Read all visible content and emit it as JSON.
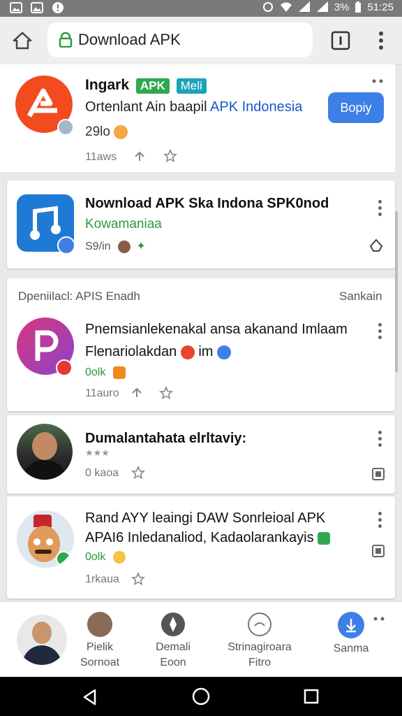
{
  "status_bar": {
    "battery": "3%",
    "time": "51:25"
  },
  "url_bar": {
    "url": "Download APK"
  },
  "cards": {
    "c1": {
      "name": "Ingark",
      "badge1": "APK",
      "badge2": "Meli",
      "subtitle_a": "Ortenlant Ain baapil ",
      "subtitle_b": "APK Indonesia",
      "rating": "29lo",
      "meta": "11aws",
      "button": "Bopiy"
    },
    "c2": {
      "title": "Nownload APK Ska Indona SPK0nod",
      "subtitle": "Kowamaniaa",
      "size": "S9/in"
    },
    "section": {
      "left": "Dpeniilacl: APIS Enadh",
      "right": "Sankain"
    },
    "c3": {
      "line1": "Pnemsianlekenakal ansa akanand Imlaam",
      "line2a": "Flenariolakdan ",
      "line2b": "im",
      "rating": "0olk",
      "meta": "11auro"
    },
    "c4": {
      "title": "Dumalantahata elrltaviy:",
      "stars": "★★★",
      "meta": "0 kaoa"
    },
    "c5": {
      "line1": "Rand AYY leaingi DAW Sonrleioal APK",
      "line2": "APAI6 Inledanaliod, Kadaolarankayis",
      "rating": "0olk",
      "meta": "1rkaua"
    }
  },
  "bottom_nav": [
    {
      "label": "Pielik",
      "sublabel": "Sornoat"
    },
    {
      "label": "Demali",
      "sublabel": "Eoon"
    },
    {
      "label": "Strinagiroara",
      "sublabel": "Fitro"
    },
    {
      "label": "Sanma",
      "sublabel": ""
    }
  ],
  "colors": {
    "accent_blue": "#3d7fe6",
    "badge_green": "#2fa84f",
    "badge_teal": "#1ba3b8",
    "link_blue": "#1a57c9",
    "green_text": "#2b9a3d"
  },
  "icons": [
    "home-icon",
    "lock-icon",
    "tabs-icon",
    "more-icon",
    "star-icon",
    "bookmark-icon",
    "download-icon",
    "back-icon",
    "home-circle-icon",
    "recents-icon"
  ]
}
